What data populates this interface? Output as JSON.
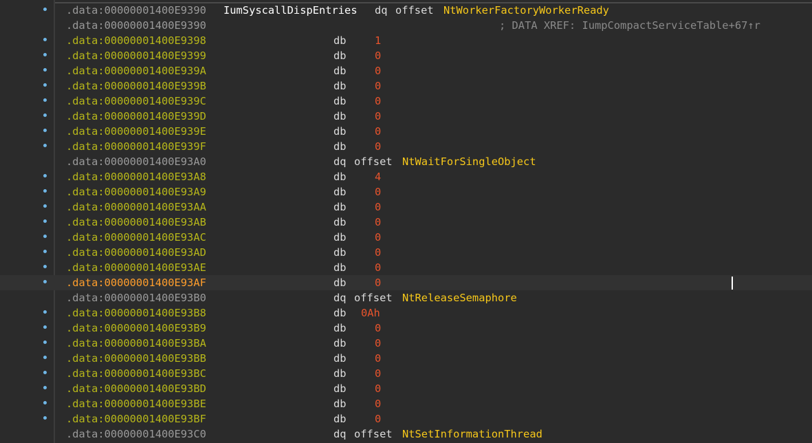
{
  "listing": {
    "rows": [
      {
        "addr": ".data:00000001400E9390",
        "dot": true,
        "label": "IumSyscallDispEntries",
        "directive": "dq",
        "keyword": "offset",
        "name": "NtWorkerFactoryWorkerReady",
        "comment": "",
        "value": ""
      },
      {
        "addr": ".data:00000001400E9390",
        "dot": false,
        "label": "",
        "directive": "",
        "keyword": "",
        "name": "",
        "comment": "; DATA XREF: IumpCompactServiceTable+67↑r",
        "value": ""
      },
      {
        "addr": ".data:00000001400E9398",
        "dot": true,
        "directive": "db",
        "value": "1"
      },
      {
        "addr": ".data:00000001400E9399",
        "dot": true,
        "directive": "db",
        "value": "0"
      },
      {
        "addr": ".data:00000001400E939A",
        "dot": true,
        "directive": "db",
        "value": "0"
      },
      {
        "addr": ".data:00000001400E939B",
        "dot": true,
        "directive": "db",
        "value": "0"
      },
      {
        "addr": ".data:00000001400E939C",
        "dot": true,
        "directive": "db",
        "value": "0"
      },
      {
        "addr": ".data:00000001400E939D",
        "dot": true,
        "directive": "db",
        "value": "0"
      },
      {
        "addr": ".data:00000001400E939E",
        "dot": true,
        "directive": "db",
        "value": "0"
      },
      {
        "addr": ".data:00000001400E939F",
        "dot": true,
        "directive": "db",
        "value": "0"
      },
      {
        "addr": ".data:00000001400E93A0",
        "dot": false,
        "directive": "dq",
        "keyword": "offset",
        "name": "NtWaitForSingleObject"
      },
      {
        "addr": ".data:00000001400E93A8",
        "dot": true,
        "directive": "db",
        "value": "4"
      },
      {
        "addr": ".data:00000001400E93A9",
        "dot": true,
        "directive": "db",
        "value": "0"
      },
      {
        "addr": ".data:00000001400E93AA",
        "dot": true,
        "directive": "db",
        "value": "0"
      },
      {
        "addr": ".data:00000001400E93AB",
        "dot": true,
        "directive": "db",
        "value": "0"
      },
      {
        "addr": ".data:00000001400E93AC",
        "dot": true,
        "directive": "db",
        "value": "0"
      },
      {
        "addr": ".data:00000001400E93AD",
        "dot": true,
        "directive": "db",
        "value": "0"
      },
      {
        "addr": ".data:00000001400E93AE",
        "dot": true,
        "directive": "db",
        "value": "0"
      },
      {
        "addr": ".data:00000001400E93AF",
        "dot": true,
        "directive": "db",
        "value": "0",
        "current": true
      },
      {
        "addr": ".data:00000001400E93B0",
        "dot": false,
        "directive": "dq",
        "keyword": "offset",
        "name": "NtReleaseSemaphore"
      },
      {
        "addr": ".data:00000001400E93B8",
        "dot": true,
        "directive": "db",
        "value": "0Ah"
      },
      {
        "addr": ".data:00000001400E93B9",
        "dot": true,
        "directive": "db",
        "value": "0"
      },
      {
        "addr": ".data:00000001400E93BA",
        "dot": true,
        "directive": "db",
        "value": "0"
      },
      {
        "addr": ".data:00000001400E93BB",
        "dot": true,
        "directive": "db",
        "value": "0"
      },
      {
        "addr": ".data:00000001400E93BC",
        "dot": true,
        "directive": "db",
        "value": "0"
      },
      {
        "addr": ".data:00000001400E93BD",
        "dot": true,
        "directive": "db",
        "value": "0"
      },
      {
        "addr": ".data:00000001400E93BE",
        "dot": true,
        "directive": "db",
        "value": "0"
      },
      {
        "addr": ".data:00000001400E93BF",
        "dot": true,
        "directive": "db",
        "value": "0"
      },
      {
        "addr": ".data:00000001400E93C0",
        "dot": false,
        "directive": "dq",
        "keyword": "offset",
        "name": "NtSetInformationThread"
      }
    ]
  },
  "colors": {
    "background": "#2b2b2b",
    "address_plain": "#9a9a9a",
    "address_byte": "#b7b71a",
    "address_current": "#ff9e2c",
    "value": "#e8542c",
    "symbol_name": "#f7c81a",
    "comment": "#8a8a8a",
    "breakpoint_dot": "#6fb6e6"
  }
}
